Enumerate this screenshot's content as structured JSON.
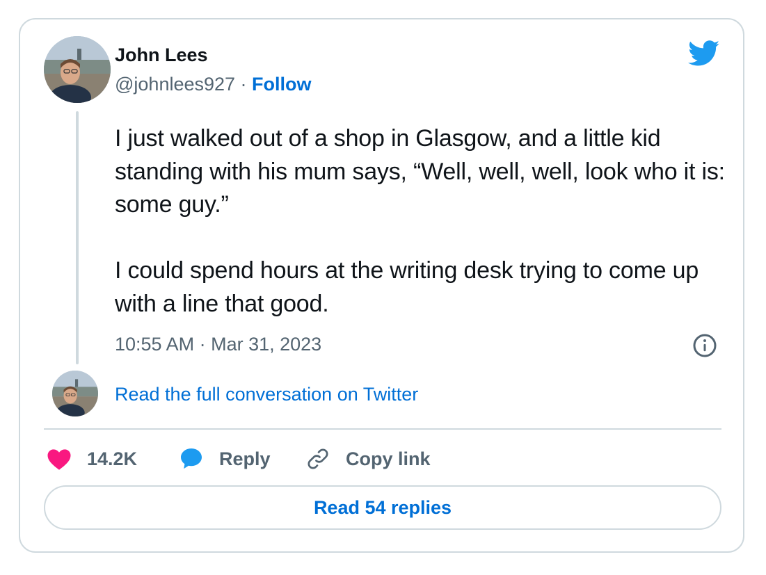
{
  "author": {
    "name": "John Lees",
    "handle": "@johnlees927",
    "separator": " · ",
    "follow_label": "Follow"
  },
  "tweet": {
    "paragraphs": [
      "I just walked out of a shop in Glasgow, and a little kid standing with his mum says, “Well, well, well, look who it is: some guy.”",
      "I could spend hours at the writing desk trying to come up with a line that good."
    ],
    "timestamp": "10:55 AM · Mar 31, 2023"
  },
  "conversation": {
    "link_label": "Read the full conversation on Twitter"
  },
  "actions": {
    "like_count": "14.2K",
    "reply_label": "Reply",
    "copy_label": "Copy link"
  },
  "replies": {
    "button_label": "Read 54 replies"
  },
  "icons": {
    "brand": "twitter-bird-icon",
    "info": "info-icon",
    "like": "heart-icon",
    "reply": "speech-bubble-icon",
    "copy": "link-icon"
  },
  "colors": {
    "twitter_blue": "#1d9bf0",
    "link_blue": "#006fd6",
    "like_pink": "#f91880",
    "muted_text": "#536471",
    "border": "#cfd9de"
  }
}
